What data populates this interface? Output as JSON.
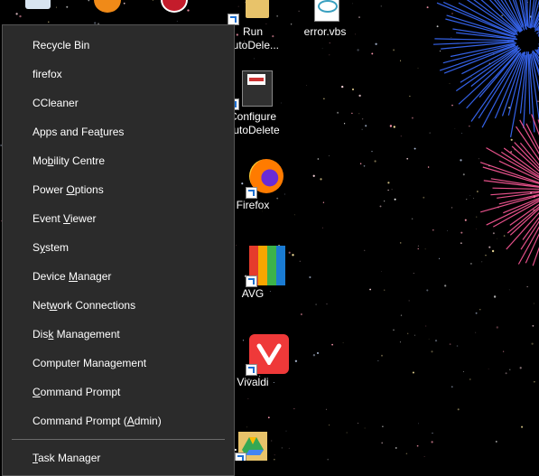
{
  "desktop": {
    "icons": [
      {
        "label": "Run\nautoDele..."
      },
      {
        "label": "error.vbs"
      },
      {
        "label": "Configure\nAutoDelete"
      },
      {
        "label": "Firefox"
      },
      {
        "label": "AVG"
      },
      {
        "label": "Vivaldi"
      }
    ]
  },
  "menu": {
    "items": [
      {
        "label": "Recycle Bin"
      },
      {
        "label": "firefox"
      },
      {
        "label": "CCleaner"
      },
      {
        "label": "Apps and Features",
        "pre": "Apps and Fea",
        "key": "t",
        "post": "ures"
      },
      {
        "label": "Mobility Centre",
        "pre": "Mo",
        "key": "b",
        "post": "ility Centre"
      },
      {
        "label": "Power Options",
        "pre": "Power ",
        "key": "O",
        "post": "ptions"
      },
      {
        "label": "Event Viewer",
        "pre": "Event ",
        "key": "V",
        "post": "iewer"
      },
      {
        "label": "System",
        "pre": "S",
        "key": "y",
        "post": "stem"
      },
      {
        "label": "Device Manager",
        "pre": "Device ",
        "key": "M",
        "post": "anager"
      },
      {
        "label": "Network Connections",
        "pre": "Net",
        "key": "w",
        "post": "ork Connections"
      },
      {
        "label": "Disk Management",
        "pre": "Dis",
        "key": "k",
        "post": " Management"
      },
      {
        "label": "Computer Management",
        "pre": "Computer Mana",
        "key": "g",
        "post": "ement"
      },
      {
        "label": "Command Prompt",
        "pre": "",
        "key": "C",
        "post": "ommand Prompt"
      },
      {
        "label": "Command Prompt (Admin)",
        "pre": "Command Prompt (",
        "key": "A",
        "post": "dmin)"
      },
      {
        "label": "Task Manager",
        "pre": "",
        "key": "T",
        "post": "ask Manager"
      }
    ]
  },
  "colors": {
    "menu_bg": "#2b2b2b",
    "menu_text": "#ffffff",
    "desktop_bg": "#000000"
  }
}
